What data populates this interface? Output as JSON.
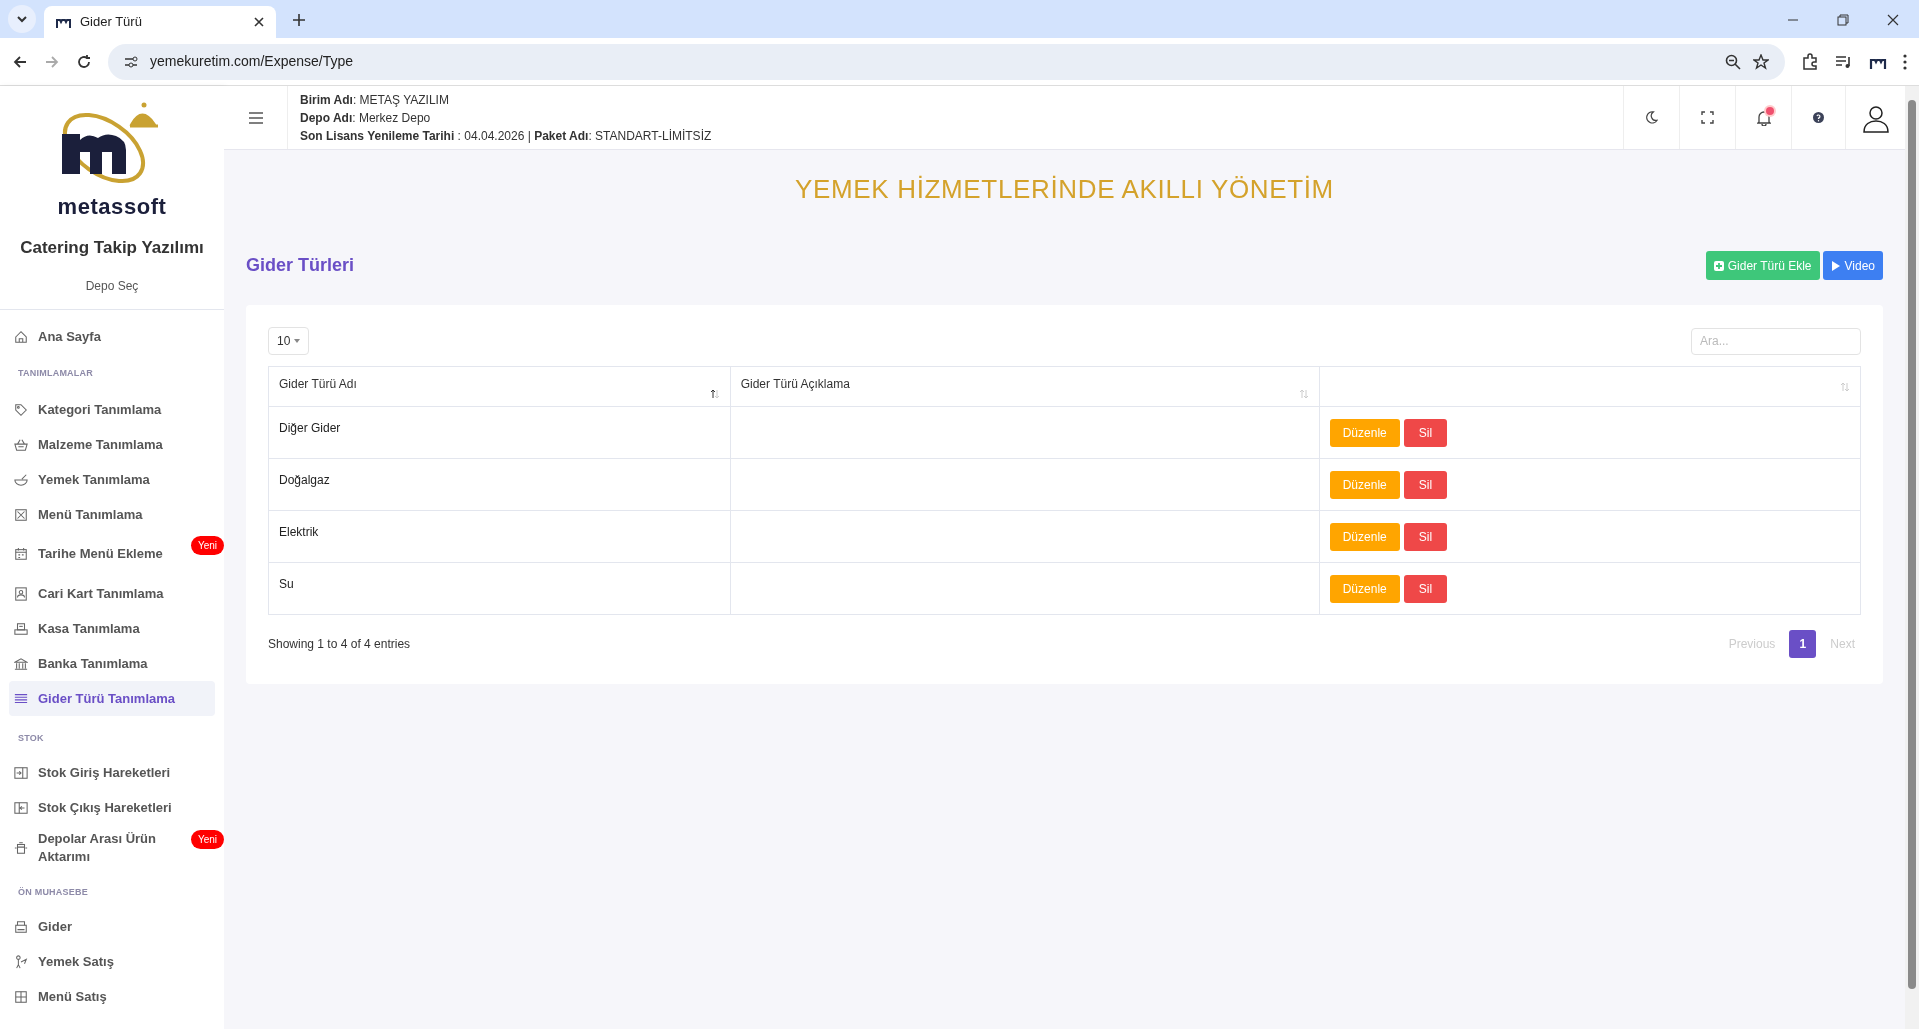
{
  "browser": {
    "tab_title": "Gider Türü",
    "url": "yemekuretim.com/Expense/Type"
  },
  "sidebar": {
    "brand": "metassoft",
    "app_name": "Catering Takip Yazılımı",
    "depot_link": "Depo Seç",
    "sections": [
      {
        "items": [
          {
            "label": "Ana Sayfa",
            "selected": false
          }
        ]
      },
      {
        "heading": "TANIMLAMALAR",
        "items": [
          {
            "label": "Kategori Tanımlama",
            "selected": false
          },
          {
            "label": "Malzeme Tanımlama",
            "selected": false
          },
          {
            "label": "Yemek Tanımlama",
            "selected": false
          },
          {
            "label": "Menü Tanımlama",
            "selected": false
          },
          {
            "label": "Tarihe Menü Ekleme",
            "selected": false,
            "badge": "Yeni"
          },
          {
            "label": "Cari Kart Tanımlama",
            "selected": false
          },
          {
            "label": "Kasa Tanımlama",
            "selected": false
          },
          {
            "label": "Banka Tanımlama",
            "selected": false
          },
          {
            "label": "Gider Türü Tanımlama",
            "selected": true
          }
        ]
      },
      {
        "heading": "STOK",
        "items": [
          {
            "label": "Stok Giriş Hareketleri",
            "selected": false
          },
          {
            "label": "Stok Çıkış Hareketleri",
            "selected": false
          },
          {
            "label": "Depolar Arası Ürün Aktarımı",
            "selected": false,
            "badge": "Yeni"
          }
        ]
      },
      {
        "heading": "ÖN MUHASEBE",
        "items": [
          {
            "label": "Gider",
            "selected": false
          },
          {
            "label": "Yemek Satış",
            "selected": false
          },
          {
            "label": "Menü Satış",
            "selected": false
          }
        ]
      }
    ]
  },
  "header": {
    "info": [
      "**Birim Adı**: METAŞ YAZILIM",
      "**Depo Adı**: Merkez Depo",
      "**Son Lisans Yenileme Tarihi** : 04.04.2026 | **Paket Adı**: STANDART-LİMİTSİZ"
    ],
    "has_notification": true
  },
  "banner": "YEMEK HİZMETLERİNDE AKILLI YÖNETİM",
  "page": {
    "title": "Gider Türleri",
    "buttons": [
      {
        "label": "Gider Türü Ekle",
        "kind": "add"
      },
      {
        "label": "Video",
        "kind": "video"
      }
    ]
  },
  "table": {
    "page_size": "10",
    "search_placeholder": "Ara...",
    "columns": [
      {
        "label": "Gider Türü Adı",
        "sorted": true
      },
      {
        "label": "Gider Türü Açıklama",
        "sorted": false
      },
      {
        "sorted": false
      }
    ],
    "rows": [
      {
        "name": "Diğer Gider",
        "actions": [
          "Düzenle",
          "Sil"
        ]
      },
      {
        "name": "Doğalgaz",
        "actions": [
          "Düzenle",
          "Sil"
        ]
      },
      {
        "name": "Elektrik",
        "actions": [
          "Düzenle",
          "Sil"
        ]
      },
      {
        "name": "Su",
        "actions": [
          "Düzenle",
          "Sil"
        ]
      }
    ],
    "info": "Showing 1 to 4 of 4 entries",
    "pagination": [
      {
        "label": "Previous",
        "kind": "nav",
        "selected": false
      },
      {
        "label": "1",
        "kind": "page",
        "selected": true
      },
      {
        "label": "Next",
        "kind": "nav",
        "selected": false
      }
    ]
  }
}
